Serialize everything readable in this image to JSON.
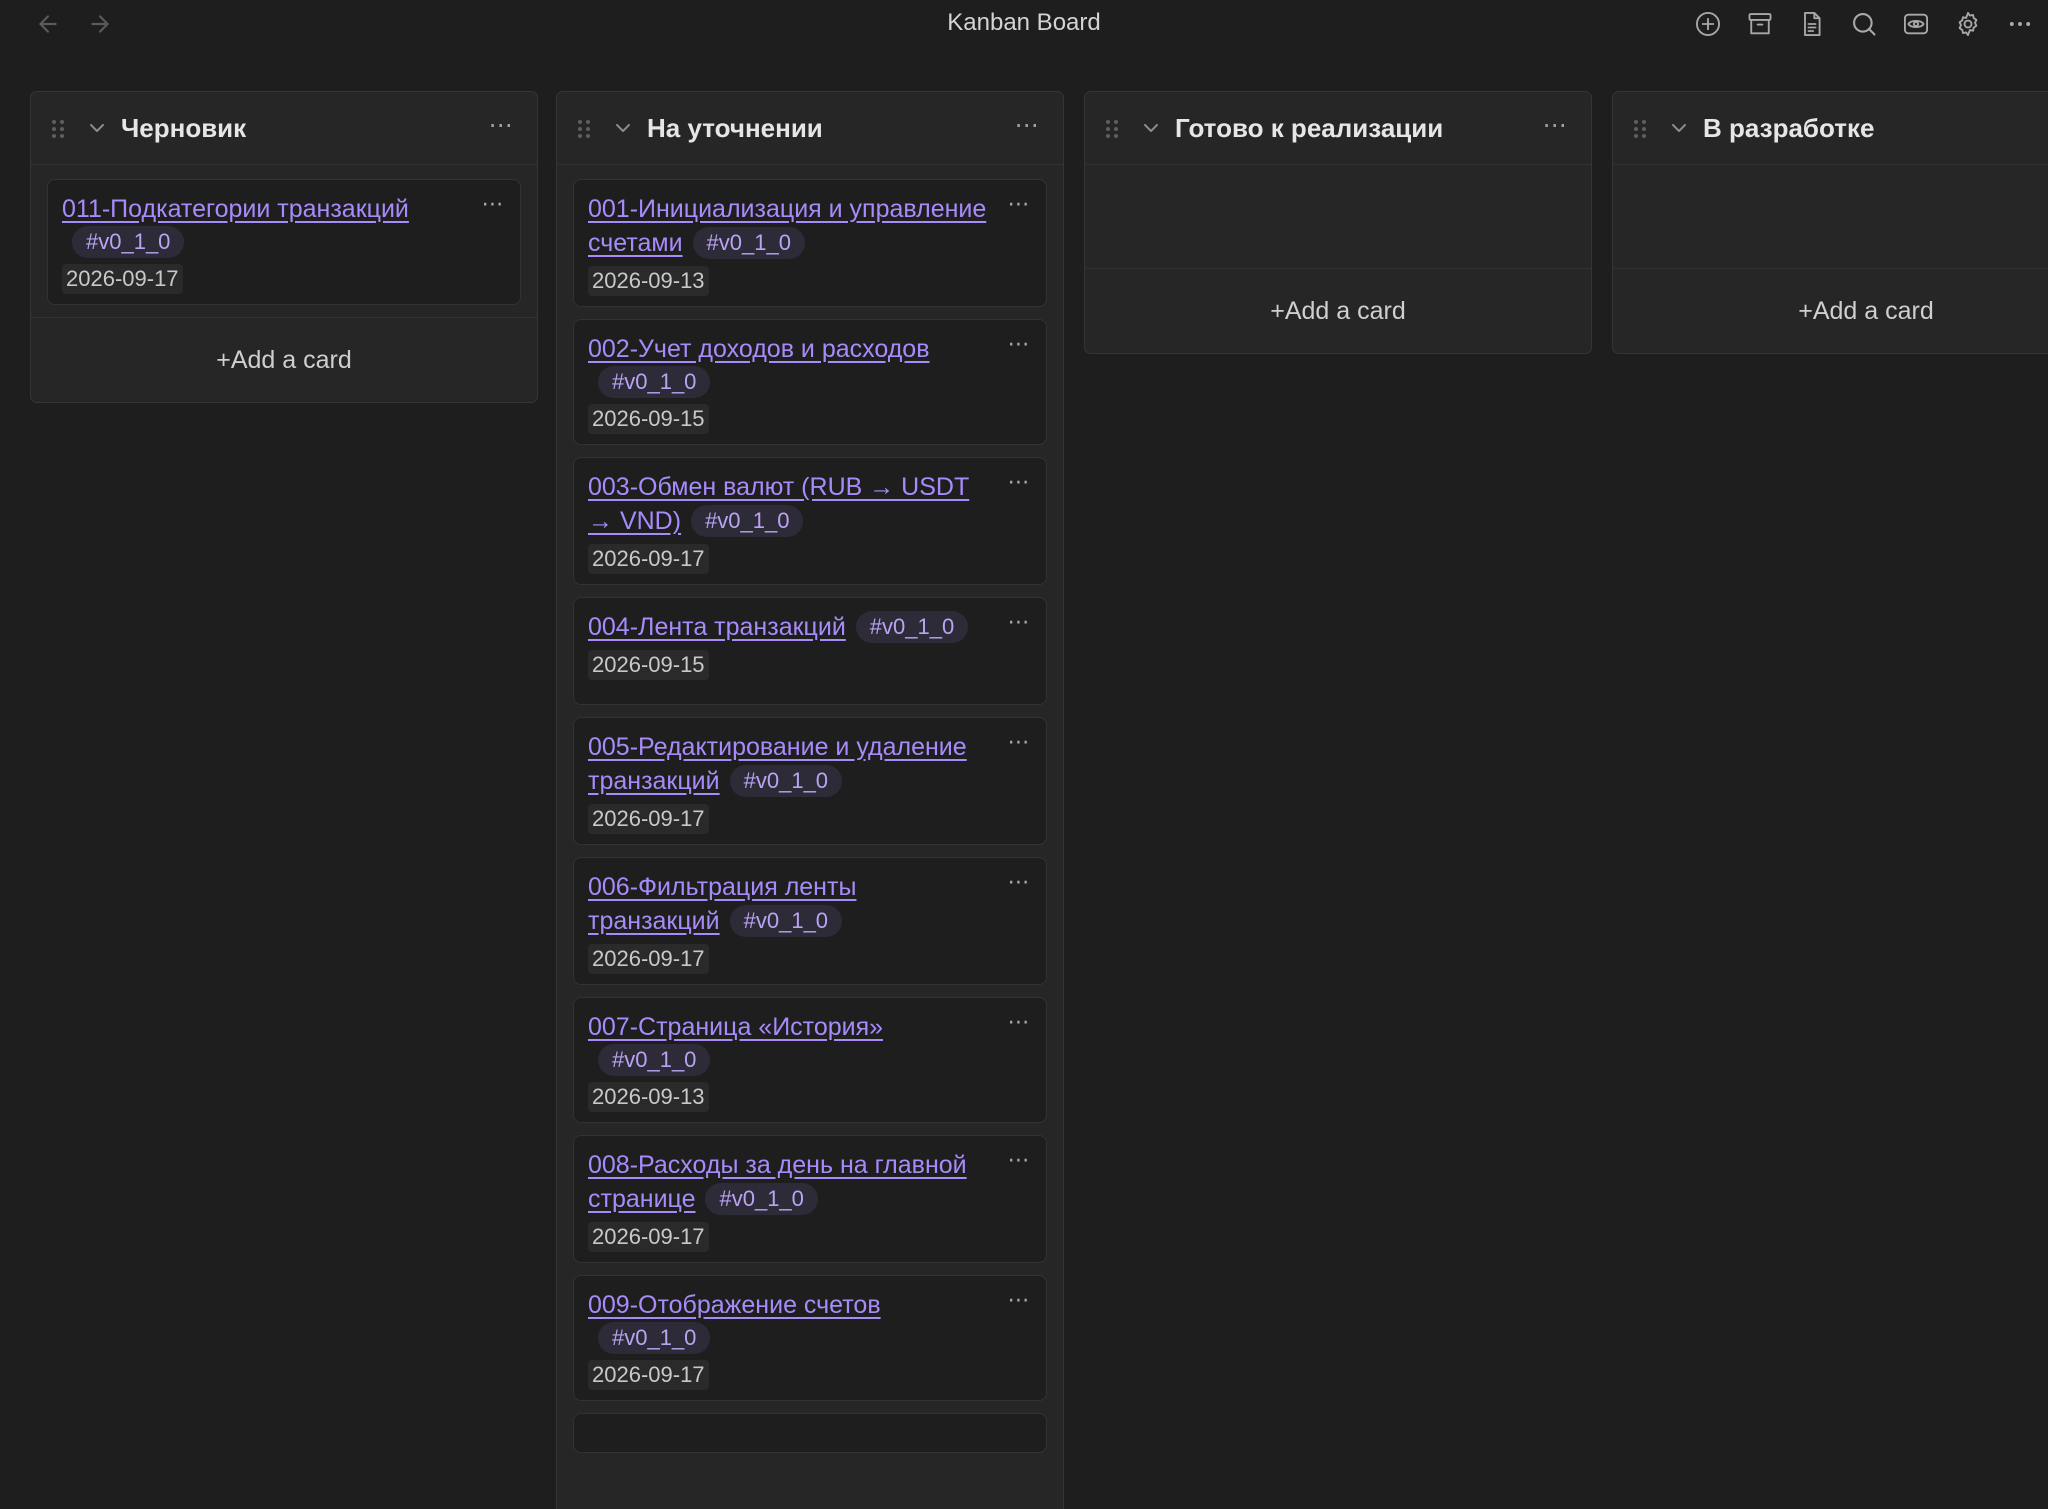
{
  "window": {
    "title": "Kanban Board"
  },
  "icons": {
    "back": "arrow-left-icon",
    "forward": "arrow-right-icon",
    "new": "plus-circle-icon",
    "archive": "archive-icon",
    "file": "document-icon",
    "search": "search-icon",
    "view": "eye-icon",
    "settings": "gear-icon",
    "more": "more-horizontal-icon"
  },
  "lane_menu_glyph": "⋯",
  "card_menu_glyph": "⋯",
  "add_card_label": "+Add a card",
  "lanes": [
    {
      "title": "Черновик",
      "cards": [
        {
          "title": "011-Подкатегории транзакций",
          "tag": "#v0_1_0",
          "date": "2026-09-17"
        }
      ]
    },
    {
      "title": "На уточнении",
      "cards": [
        {
          "title": "001-Инициализация и управление счетами",
          "tag": "#v0_1_0",
          "date": "2026-09-13"
        },
        {
          "title": "002-Учет доходов и расходов",
          "tag": "#v0_1_0",
          "date": "2026-09-15"
        },
        {
          "title": "003-Обмен валют (RUB → USDT → VND)",
          "tag": "#v0_1_0",
          "date": "2026-09-17"
        },
        {
          "title": "004-Лента транзакций",
          "tag": "#v0_1_0",
          "date": "2026-09-15"
        },
        {
          "title": "005-Редактирование и удаление транзакций",
          "tag": "#v0_1_0",
          "date": "2026-09-17"
        },
        {
          "title": "006-Фильтрация ленты транзакций",
          "tag": "#v0_1_0",
          "date": "2026-09-17"
        },
        {
          "title": "007-Страница «История»",
          "tag": "#v0_1_0",
          "date": "2026-09-13"
        },
        {
          "title": "008-Расходы за день на главной странице",
          "tag": "#v0_1_0",
          "date": "2026-09-17"
        },
        {
          "title": "009-Отображение счетов",
          "tag": "#v0_1_0",
          "date": "2026-09-17"
        }
      ]
    },
    {
      "title": "Готово к реализации",
      "cards": []
    },
    {
      "title": "В разработке",
      "cards": []
    }
  ]
}
